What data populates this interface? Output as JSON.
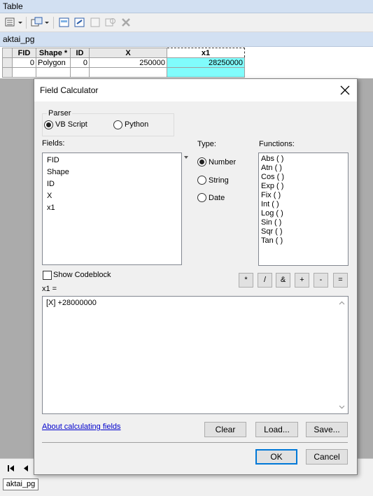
{
  "window": {
    "title": "Table"
  },
  "table": {
    "layer_name": "aktai_pg",
    "columns": [
      "FID",
      "Shape *",
      "ID",
      "X",
      "x1"
    ],
    "rows": [
      {
        "FID": "0",
        "Shape": "Polygon",
        "ID": "0",
        "X": "250000",
        "x1": "28250000"
      }
    ],
    "bottom_tab": "aktai_pg"
  },
  "dialog": {
    "title": "Field Calculator",
    "parser": {
      "label": "Parser",
      "options": [
        "VB Script",
        "Python"
      ],
      "selected": "VB Script"
    },
    "fields": {
      "label": "Fields:",
      "items": [
        "FID",
        "Shape",
        "ID",
        "X",
        "x1"
      ]
    },
    "type": {
      "label": "Type:",
      "options": [
        "Number",
        "String",
        "Date"
      ],
      "selected": "Number"
    },
    "functions": {
      "label": "Functions:",
      "items": [
        "Abs ( )",
        "Atn ( )",
        "Cos ( )",
        "Exp ( )",
        "Fix ( )",
        "Int ( )",
        "Log ( )",
        "Sin ( )",
        "Sqr ( )",
        "Tan ( )"
      ]
    },
    "show_codeblock": {
      "label": "Show Codeblock",
      "checked": false
    },
    "operators": [
      "*",
      "/",
      "&",
      "+",
      "-",
      "="
    ],
    "expression": {
      "label": "x1 =",
      "value": "[X] +28000000"
    },
    "about_link": "About calculating fields",
    "buttons": {
      "clear": "Clear",
      "load": "Load...",
      "save": "Save...",
      "ok": "OK",
      "cancel": "Cancel"
    }
  },
  "colors": {
    "highlight_cell": "#80fcfc",
    "title_bar": "#d2e0f2",
    "link": "#0000cc"
  }
}
